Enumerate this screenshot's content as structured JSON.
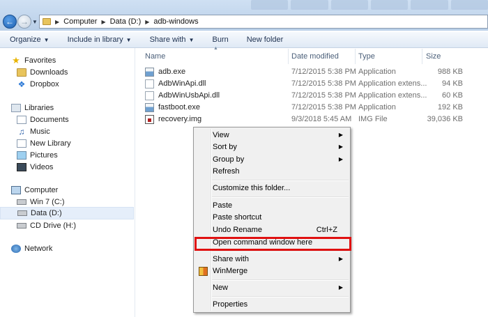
{
  "address_bar": {
    "path": [
      "Computer",
      "Data (D:)",
      "adb-windows"
    ]
  },
  "toolbar": {
    "organize": "Organize",
    "include_in_library": "Include in library",
    "share_with": "Share with",
    "burn": "Burn",
    "new_folder": "New folder"
  },
  "navigation": {
    "favorites": {
      "label": "Favorites",
      "items": [
        "Downloads",
        "Dropbox"
      ]
    },
    "libraries": {
      "label": "Libraries",
      "items": [
        "Documents",
        "Music",
        "New Library",
        "Pictures",
        "Videos"
      ]
    },
    "computer": {
      "label": "Computer",
      "items": [
        "Win 7 (C:)",
        "Data (D:)",
        "CD Drive (H:)"
      ],
      "selected": "Data (D:)"
    },
    "network": {
      "label": "Network"
    }
  },
  "columns": {
    "name": "Name",
    "date_modified": "Date modified",
    "type": "Type",
    "size": "Size"
  },
  "files": [
    {
      "name": "adb.exe",
      "date": "7/12/2015 5:38 PM",
      "type": "Application",
      "size": "988 KB",
      "icon": "exe-icon"
    },
    {
      "name": "AdbWinApi.dll",
      "date": "7/12/2015 5:38 PM",
      "type": "Application extens...",
      "size": "94 KB",
      "icon": "dll-icon"
    },
    {
      "name": "AdbWinUsbApi.dll",
      "date": "7/12/2015 5:38 PM",
      "type": "Application extens...",
      "size": "60 KB",
      "icon": "dll-icon"
    },
    {
      "name": "fastboot.exe",
      "date": "7/12/2015 5:38 PM",
      "type": "Application",
      "size": "192 KB",
      "icon": "exe-icon"
    },
    {
      "name": "recovery.img",
      "date": "9/3/2018 5:45 AM",
      "type": "IMG File",
      "size": "39,036 KB",
      "icon": "img-icon"
    }
  ],
  "context_menu": {
    "view": "View",
    "sort_by": "Sort by",
    "group_by": "Group by",
    "refresh": "Refresh",
    "customize": "Customize this folder...",
    "paste": "Paste",
    "paste_shortcut": "Paste shortcut",
    "undo_rename": "Undo Rename",
    "undo_shortcut": "Ctrl+Z",
    "open_command_window": "Open command window here",
    "share_with": "Share with",
    "winmerge": "WinMerge",
    "new": "New",
    "properties": "Properties"
  },
  "colors": {
    "highlight_border": "#e01010",
    "selected_nav": "#e5eefa"
  }
}
